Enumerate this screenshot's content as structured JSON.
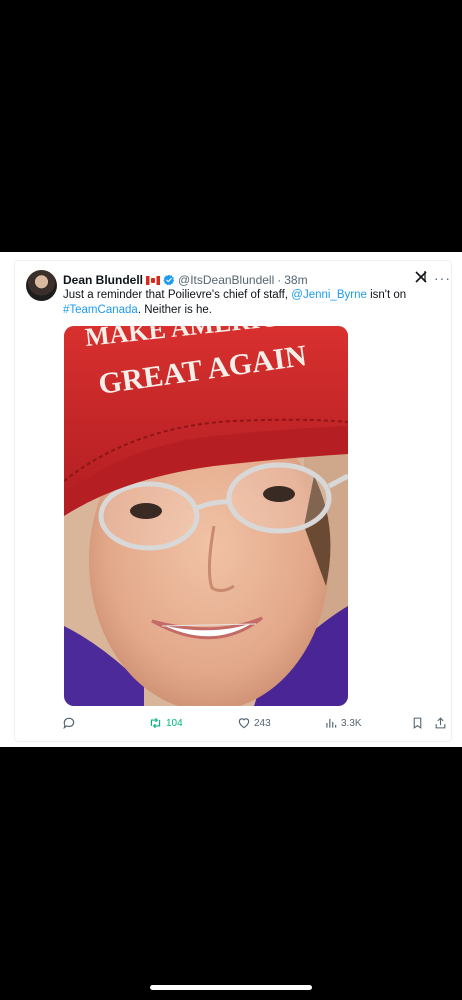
{
  "tweet": {
    "display_name": "Dean Blundell",
    "handle": "@ItsDeanBlundell",
    "separator": "·",
    "time": "38m",
    "text_part1": "Just a reminder that Poilievre's chief of staff, ",
    "mention": "@Jenni_Byrne",
    "text_part2": " isn't on",
    "hashtag": "#TeamCanada",
    "text_part3": ".  Neither is he.",
    "image_hat_text": "GREAT AGAIN",
    "image_hat_text_top": "MAKE AMERICA"
  },
  "header_icons": {
    "x_logo": "x-logo",
    "more_label": "···"
  },
  "actions": {
    "reply_count": "",
    "retweet_count": "104",
    "like_count": "243",
    "views_count": "3.3K"
  },
  "colors": {
    "accent": "#1d9bf0",
    "retweet_active": "#00ba7c",
    "muted": "#536471",
    "hat_red": "#c8252b"
  }
}
